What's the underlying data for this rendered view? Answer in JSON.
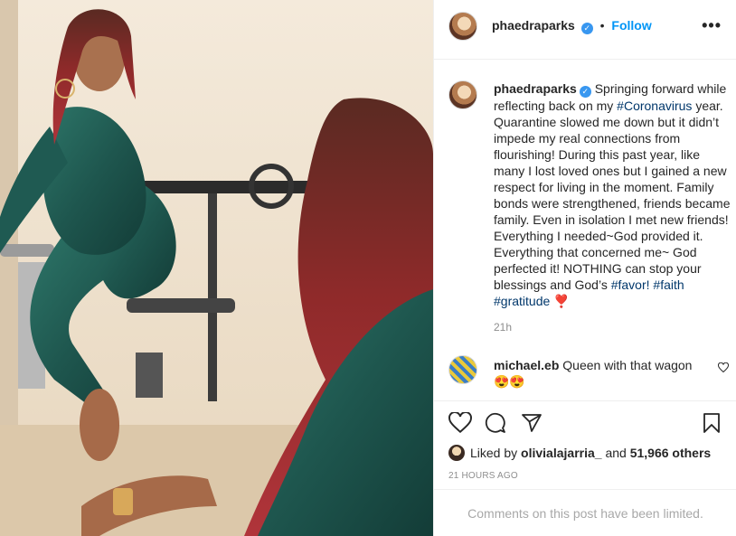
{
  "post": {
    "username": "phaedraparks",
    "verified_mark": "✓",
    "separator": "•",
    "follow_label": "Follow",
    "more_label": "•••"
  },
  "caption": {
    "username": "phaedraparks",
    "text_1": "Springing forward while reflecting back on my ",
    "tag_coronavirus": "#Coronavirus",
    "text_2": " year. Quarantine slowed me down but it didn’t impede my real connections from flourishing! During this past year, like many I lost loved ones but I gained a new respect for living in the moment. Family bonds were strengthened, friends became family. Even in isolation I met new friends! Everything I needed~God provided it. Everything that concerned me~ God perfected it! NOTHING can stop your blessings and God’s ",
    "tag_favor": "#favor!",
    "tag_faith": "#faith",
    "tag_gratitude": "#gratitude",
    "heart_emoji": "❣️",
    "time": "21h"
  },
  "comment": {
    "username": "michael.eb",
    "text": "Queen with that wagon",
    "emoji": "😍😍"
  },
  "actions": {
    "like_icon": "heart-outline-icon",
    "comment_icon": "comment-bubble-icon",
    "share_icon": "paper-plane-icon",
    "save_icon": "bookmark-icon"
  },
  "likes": {
    "prefix": "Liked by ",
    "user": "olivialajarria_",
    "and": " and ",
    "count": "51,966 others"
  },
  "posted_ago": "21 HOURS AGO",
  "comments_limited": "Comments on this post have been limited.",
  "colors": {
    "link_blue": "#0095f6",
    "hashtag": "#00376b",
    "muted": "#8e8e8e",
    "verified": "#3897f0",
    "outfit_green": "#1f5a52",
    "hair_red": "#8f2a2a"
  }
}
